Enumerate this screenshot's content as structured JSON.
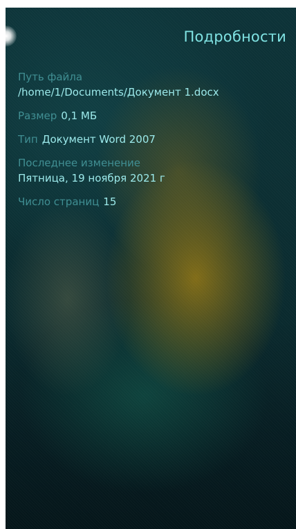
{
  "header": {
    "title": "Подробности"
  },
  "details": {
    "file_path_label": "Путь файла",
    "file_path_value": "/home/1/Documents/Документ 1.docx",
    "size_label": "Размер",
    "size_value": "0,1 МБ",
    "type_label": "Тип",
    "type_value": "Документ Word 2007",
    "modified_label": "Последнее изменение",
    "modified_value": "Пятница, 19 ноября 2021 г",
    "pages_label": "Число страниц",
    "pages_value": "15"
  },
  "colors": {
    "accent": "#7fe3e3",
    "label": "#3f8e92",
    "value": "#9be9ea",
    "background": "#0c2f33"
  }
}
